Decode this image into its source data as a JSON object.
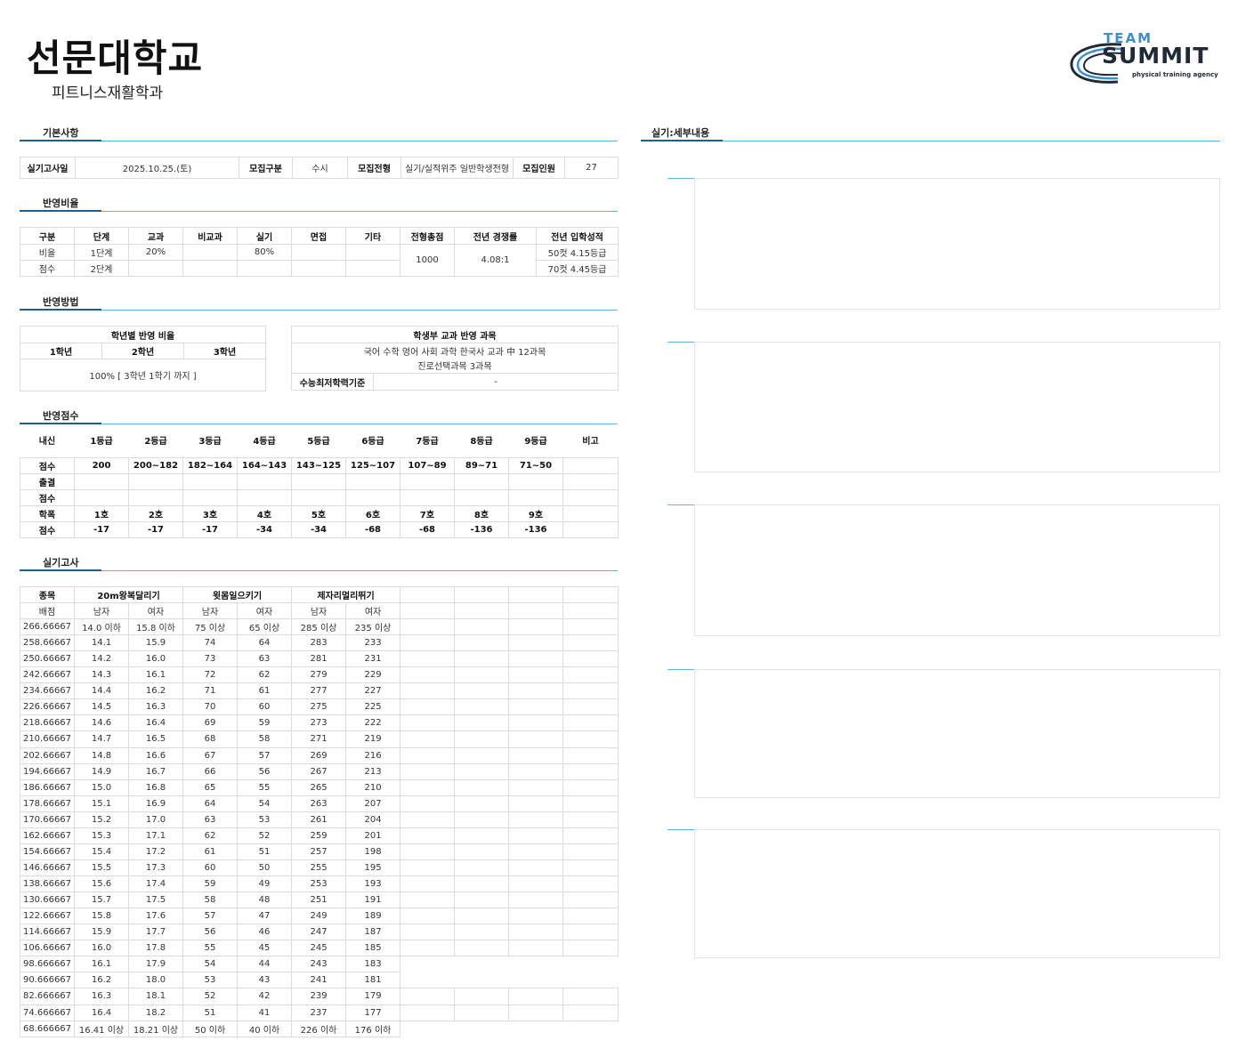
{
  "header": {
    "university": "선문대학교",
    "department": "피트니스재활학과"
  },
  "logo": {
    "line1": "TEAM",
    "line2": "SUMMIT",
    "line3": "physical training agency",
    "colors": {
      "accent": "#3a8fd1",
      "dark": "#1f2a36"
    }
  },
  "sections": {
    "basic": "기본사항",
    "ratio": "반영비율",
    "method": "반영방법",
    "score": "반영점수",
    "practical": "실기고사",
    "detail": "실기:세부내용"
  },
  "basic": {
    "exam_date_label": "실기고사일",
    "exam_date": "2025.10.25.(토)",
    "type_label": "모집구분",
    "type": "수시",
    "track_label": "모집전형",
    "track": "실기/실적위주 일반학생전형",
    "count_label": "모집인원",
    "count": "27"
  },
  "ratio": {
    "headers": [
      "구분",
      "단계",
      "교과",
      "비교과",
      "실기",
      "면접",
      "기타",
      "전형총점",
      "전년 경쟁률",
      "전년 입학성적"
    ],
    "row1": [
      "비율",
      "1단계",
      "20%",
      "",
      "80%",
      "",
      ""
    ],
    "row2": [
      "점수",
      "2단계",
      "",
      "",
      "",
      "",
      ""
    ],
    "total": "1000",
    "competition": "4.08:1",
    "result1": "50컷 4.15등급",
    "result2": "70컷 4.45등급"
  },
  "method": {
    "grade_title": "학년별 반영 비율",
    "grades": [
      "1학년",
      "2학년",
      "3학년"
    ],
    "grade_value": "100% [ 3학년 1학기 까지 ]",
    "subject_title": "학생부 교과 반영 과목",
    "subject_line1": "국어 수학 영어 사회 과학 한국사 교과 中 12과목",
    "subject_line2": "진로선택과목 3과목",
    "min_label": "수능최저학력기준",
    "min_value": "-"
  },
  "score": {
    "header": [
      "내신",
      "1등급",
      "2등급",
      "3등급",
      "4등급",
      "5등급",
      "6등급",
      "7등급",
      "8등급",
      "9등급",
      "비고"
    ],
    "grade_row": [
      "점수",
      "200",
      "200~182",
      "182~164",
      "164~143",
      "143~125",
      "125~107",
      "107~89",
      "89~71",
      "71~50",
      ""
    ],
    "attend_label": "출결",
    "attend_score_label": "점수",
    "absence_row": [
      "학폭",
      "1호",
      "2호",
      "3호",
      "4호",
      "5호",
      "6호",
      "7호",
      "8호",
      "9호",
      ""
    ],
    "absence_score_row": [
      "점수",
      "-17",
      "-17",
      "-17",
      "-34",
      "-34",
      "-68",
      "-68",
      "-136",
      "-136",
      ""
    ]
  },
  "practical": {
    "item_label": "종목",
    "events": [
      "20m왕복달리기",
      "윗몸일으키기",
      "제자리멀리뛰기"
    ],
    "score_label": "배점",
    "male": "남자",
    "female": "여자",
    "rows": [
      [
        "266.66667",
        "14.0 이하",
        "15.8 이하",
        "75 이상",
        "65 이상",
        "285 이상",
        "235 이상"
      ],
      [
        "258.66667",
        "14.1",
        "15.9",
        "74",
        "64",
        "283",
        "233"
      ],
      [
        "250.66667",
        "14.2",
        "16.0",
        "73",
        "63",
        "281",
        "231"
      ],
      [
        "242.66667",
        "14.3",
        "16.1",
        "72",
        "62",
        "279",
        "229"
      ],
      [
        "234.66667",
        "14.4",
        "16.2",
        "71",
        "61",
        "277",
        "227"
      ],
      [
        "226.66667",
        "14.5",
        "16.3",
        "70",
        "60",
        "275",
        "225"
      ],
      [
        "218.66667",
        "14.6",
        "16.4",
        "69",
        "59",
        "273",
        "222"
      ],
      [
        "210.66667",
        "14.7",
        "16.5",
        "68",
        "58",
        "271",
        "219"
      ],
      [
        "202.66667",
        "14.8",
        "16.6",
        "67",
        "57",
        "269",
        "216"
      ],
      [
        "194.66667",
        "14.9",
        "16.7",
        "66",
        "56",
        "267",
        "213"
      ],
      [
        "186.66667",
        "15.0",
        "16.8",
        "65",
        "55",
        "265",
        "210"
      ],
      [
        "178.66667",
        "15.1",
        "16.9",
        "64",
        "54",
        "263",
        "207"
      ],
      [
        "170.66667",
        "15.2",
        "17.0",
        "63",
        "53",
        "261",
        "204"
      ],
      [
        "162.66667",
        "15.3",
        "17.1",
        "62",
        "52",
        "259",
        "201"
      ],
      [
        "154.66667",
        "15.4",
        "17.2",
        "61",
        "51",
        "257",
        "198"
      ],
      [
        "146.66667",
        "15.5",
        "17.3",
        "60",
        "50",
        "255",
        "195"
      ],
      [
        "138.66667",
        "15.6",
        "17.4",
        "59",
        "49",
        "253",
        "193"
      ],
      [
        "130.66667",
        "15.7",
        "17.5",
        "58",
        "48",
        "251",
        "191"
      ],
      [
        "122.66667",
        "15.8",
        "17.6",
        "57",
        "47",
        "249",
        "189"
      ],
      [
        "114.66667",
        "15.9",
        "17.7",
        "56",
        "46",
        "247",
        "187"
      ],
      [
        "106.66667",
        "16.0",
        "17.8",
        "55",
        "45",
        "245",
        "185"
      ],
      [
        "98.666667",
        "16.1",
        "17.9",
        "54",
        "44",
        "243",
        "183"
      ],
      [
        "90.666667",
        "16.2",
        "18.0",
        "53",
        "43",
        "241",
        "181"
      ],
      [
        "82.666667",
        "16.3",
        "18.1",
        "52",
        "42",
        "239",
        "179"
      ],
      [
        "74.666667",
        "16.4",
        "18.2",
        "51",
        "41",
        "237",
        "177"
      ],
      [
        "68.666667",
        "16.41 이상",
        "18.21 이상",
        "50 이하",
        "40 이하",
        "226 이하",
        "176 이하"
      ]
    ]
  }
}
